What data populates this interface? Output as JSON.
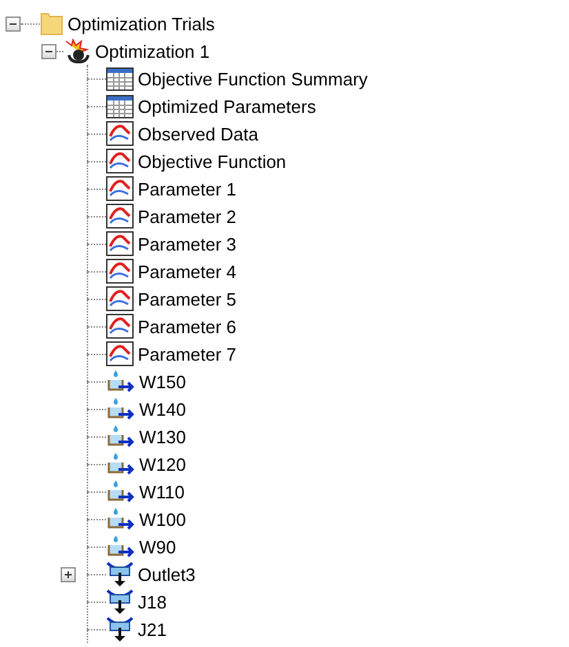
{
  "tree": {
    "label": "Optimization Trials",
    "kind": "folder",
    "expanded": true,
    "children": [
      {
        "label": "Optimization 1",
        "kind": "trial",
        "expanded": true,
        "children": [
          {
            "label": "Objective Function Summary",
            "kind": "table"
          },
          {
            "label": "Optimized Parameters",
            "kind": "table"
          },
          {
            "label": "Observed Data",
            "kind": "graph"
          },
          {
            "label": "Objective Function",
            "kind": "graph"
          },
          {
            "label": "Parameter 1",
            "kind": "graph"
          },
          {
            "label": "Parameter 2",
            "kind": "graph"
          },
          {
            "label": "Parameter 3",
            "kind": "graph"
          },
          {
            "label": "Parameter 4",
            "kind": "graph"
          },
          {
            "label": "Parameter 5",
            "kind": "graph"
          },
          {
            "label": "Parameter 6",
            "kind": "graph"
          },
          {
            "label": "Parameter 7",
            "kind": "graph"
          },
          {
            "label": "W150",
            "kind": "subbasin"
          },
          {
            "label": "W140",
            "kind": "subbasin"
          },
          {
            "label": "W130",
            "kind": "subbasin"
          },
          {
            "label": "W120",
            "kind": "subbasin"
          },
          {
            "label": "W110",
            "kind": "subbasin"
          },
          {
            "label": "W100",
            "kind": "subbasin"
          },
          {
            "label": "W90",
            "kind": "subbasin"
          },
          {
            "label": "Outlet3",
            "kind": "junction",
            "expanded": false
          },
          {
            "label": "J18",
            "kind": "junction"
          },
          {
            "label": "J21",
            "kind": "junction"
          }
        ]
      }
    ]
  }
}
